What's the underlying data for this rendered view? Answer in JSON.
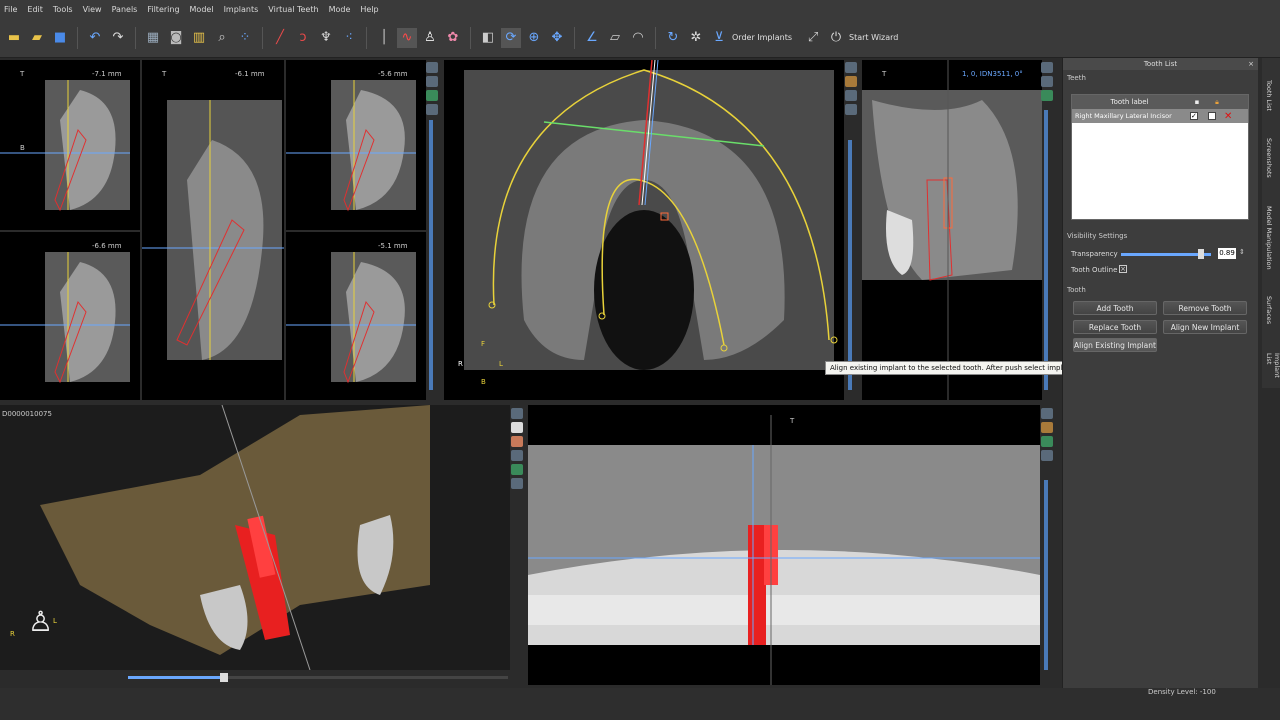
{
  "menu": [
    "File",
    "Edit",
    "Tools",
    "View",
    "Panels",
    "Filtering",
    "Model",
    "Implants",
    "Virtual Teeth",
    "Mode",
    "Help"
  ],
  "toolbar": {
    "order_implants": "Order Implants",
    "start_wizard": "Start Wizard"
  },
  "slices": {
    "s1": "-7.1 mm",
    "s2": "-6.1 mm",
    "s3": "-5.6 mm",
    "s4": "-6.6 mm",
    "s5": "-5.1 mm",
    "t": "T",
    "b": "B"
  },
  "sagittal": {
    "info": "1, 0, IDN3511, 0°"
  },
  "view3d": {
    "id": "D0000010075"
  },
  "orientation": {
    "r": "R",
    "l": "L",
    "f": "F",
    "b": "B",
    "t": "T"
  },
  "panel": {
    "title": "Tooth List",
    "teeth_label": "Teeth",
    "col_label": "Tooth label",
    "row_label": "Right Maxillary Lateral Incisor",
    "visibility_label": "Visibility Settings",
    "transparency_label": "Transparency",
    "transparency_value": "0.89",
    "outline_label": "Tooth Outline",
    "tooth_label": "Tooth",
    "buttons": {
      "add": "Add Tooth",
      "remove": "Remove Tooth",
      "replace": "Replace Tooth",
      "align_new": "Align New Implant",
      "align_existing": "Align Existing Implant"
    }
  },
  "tooltip": "Align existing implant to the selected tooth. After push select implant to align.",
  "right_tabs": [
    "Tooth List",
    "Screenshots",
    "Model Manipulation",
    "Surfaces",
    "Implant List"
  ],
  "status": {
    "density": "Density Level: -100"
  },
  "colors": {
    "accent_red": "#e01010",
    "implant_red": "#ff3a3a",
    "curve_yellow": "#e8d23a",
    "line_blue": "#6aa8ff"
  }
}
